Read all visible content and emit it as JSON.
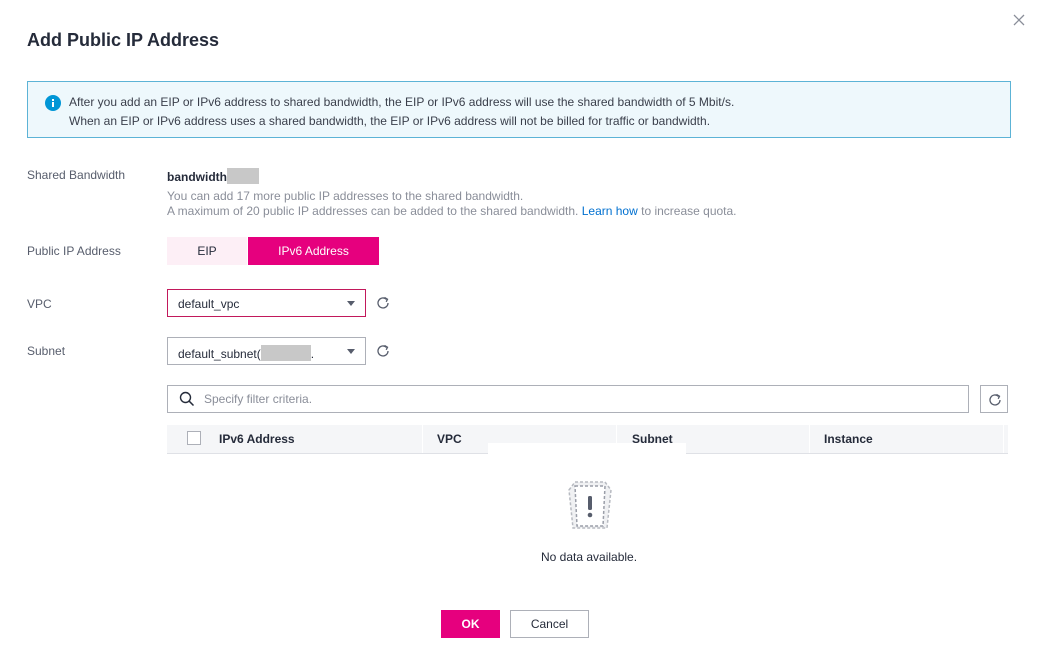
{
  "dialog": {
    "title": "Add Public IP Address"
  },
  "notice": {
    "line1": "After you add an EIP or IPv6 address to shared bandwidth, the EIP or IPv6 address will use the shared bandwidth of 5 Mbit/s.",
    "line2": "When an EIP or IPv6 address uses a shared bandwidth, the EIP or IPv6 address will not be billed for traffic or bandwidth."
  },
  "shared_bandwidth": {
    "label": "Shared Bandwidth",
    "name": "bandwidth",
    "hint1": "You can add 17 more public IP addresses to the shared bandwidth.",
    "hint2_prefix": "A maximum of 20 public IP addresses can be added to the shared bandwidth.",
    "hint2_link": "Learn how",
    "hint2_suffix": "to increase quota."
  },
  "public_ip": {
    "label": "Public IP Address",
    "options": [
      "EIP",
      "IPv6 Address"
    ],
    "selected": "IPv6 Address"
  },
  "vpc": {
    "label": "VPC",
    "value": "default_vpc"
  },
  "subnet": {
    "label": "Subnet",
    "value_prefix": "default_subnet(",
    "value_suffix": "."
  },
  "filter": {
    "placeholder": "Specify filter criteria."
  },
  "table": {
    "columns": [
      "IPv6 Address",
      "VPC",
      "Subnet",
      "Instance"
    ],
    "rows": [],
    "empty_text": "No data available."
  },
  "footer": {
    "ok_label": "OK",
    "cancel_label": "Cancel"
  },
  "colors": {
    "accent": "#e6007e",
    "notice_border": "#5cb3d6",
    "notice_bg": "#eef8fc",
    "info_icon": "#0096d6",
    "link": "#0070d0"
  },
  "icons": [
    "close-icon",
    "info-icon",
    "refresh-icon",
    "search-icon",
    "chevron-down-icon",
    "empty-state-icon"
  ]
}
